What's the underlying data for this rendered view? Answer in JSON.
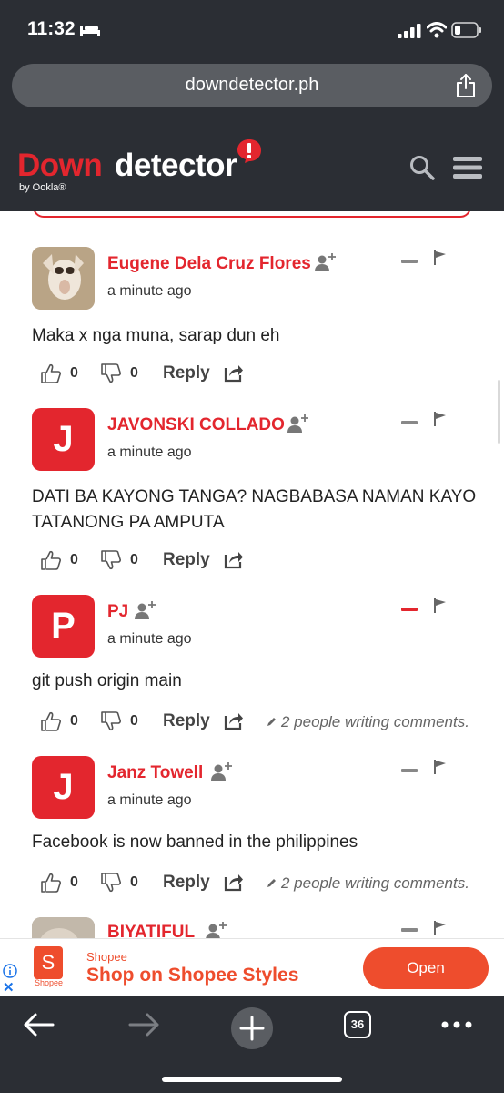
{
  "status_bar": {
    "time": "11:32"
  },
  "browser": {
    "url": "downdetector.ph",
    "tab_count": "36"
  },
  "site": {
    "logo_part1": "Down",
    "logo_part2": "detector",
    "logo_sub": "by Ookla®"
  },
  "comments": [
    {
      "author": "Eugene Dela Cruz Flores",
      "avatar_letter": "",
      "time": "a minute ago",
      "body": "Maka x nga muna, sarap dun eh",
      "likes": "0",
      "dislikes": "0",
      "reply": "Reply",
      "writing": ""
    },
    {
      "author": "JAVONSKI COLLADO",
      "avatar_letter": "J",
      "time": "a minute ago",
      "body": "DATI BA KAYONG TANGA? NAGBABASA NAMAN KAYO TATANONG PA AMPUTA",
      "likes": "0",
      "dislikes": "0",
      "reply": "Reply",
      "writing": ""
    },
    {
      "author": "PJ",
      "avatar_letter": "P",
      "time": "a minute ago",
      "body": "git push origin main",
      "likes": "0",
      "dislikes": "0",
      "reply": "Reply",
      "writing": "2 people writing comments."
    },
    {
      "author": "Janz Towell",
      "avatar_letter": "J",
      "time": "a minute ago",
      "body": "Facebook is now banned in the philippines",
      "likes": "0",
      "dislikes": "0",
      "reply": "Reply",
      "writing": "2 people writing comments."
    },
    {
      "author": "BIYATIFUL",
      "avatar_letter": ""
    }
  ],
  "ad": {
    "brand": "Shopee",
    "logo_caption": "Shopee",
    "headline": "Shop on Shopee Styles",
    "button": "Open",
    "close": "✕"
  },
  "colors": {
    "accent": "#e3262e",
    "chrome": "#2b2e34",
    "shopee": "#ee4d2d"
  }
}
